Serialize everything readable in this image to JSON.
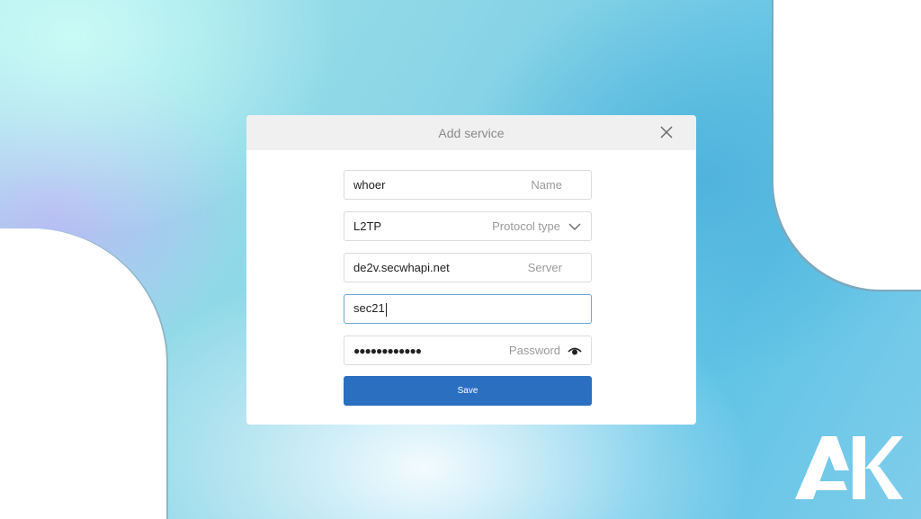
{
  "dialog": {
    "title": "Add service",
    "close_icon": "close-icon"
  },
  "form": {
    "name": {
      "value": "whoer",
      "label": "Name"
    },
    "protocol": {
      "value": "L2TP",
      "label": "Protocol type",
      "icon": "chevron-down-icon"
    },
    "server": {
      "value": "de2v.secwhapi.net",
      "label": "Server"
    },
    "username": {
      "value": "sec21"
    },
    "password": {
      "value": "●●●●●●●●●●●●",
      "label": "Password",
      "icon": "eye-icon"
    },
    "save_label": "Save"
  },
  "logo": {
    "text": "AK"
  },
  "colors": {
    "primary_button": "#2b6fc0",
    "active_border": "#6ea5d8",
    "header_bg": "#f0f0f0"
  }
}
